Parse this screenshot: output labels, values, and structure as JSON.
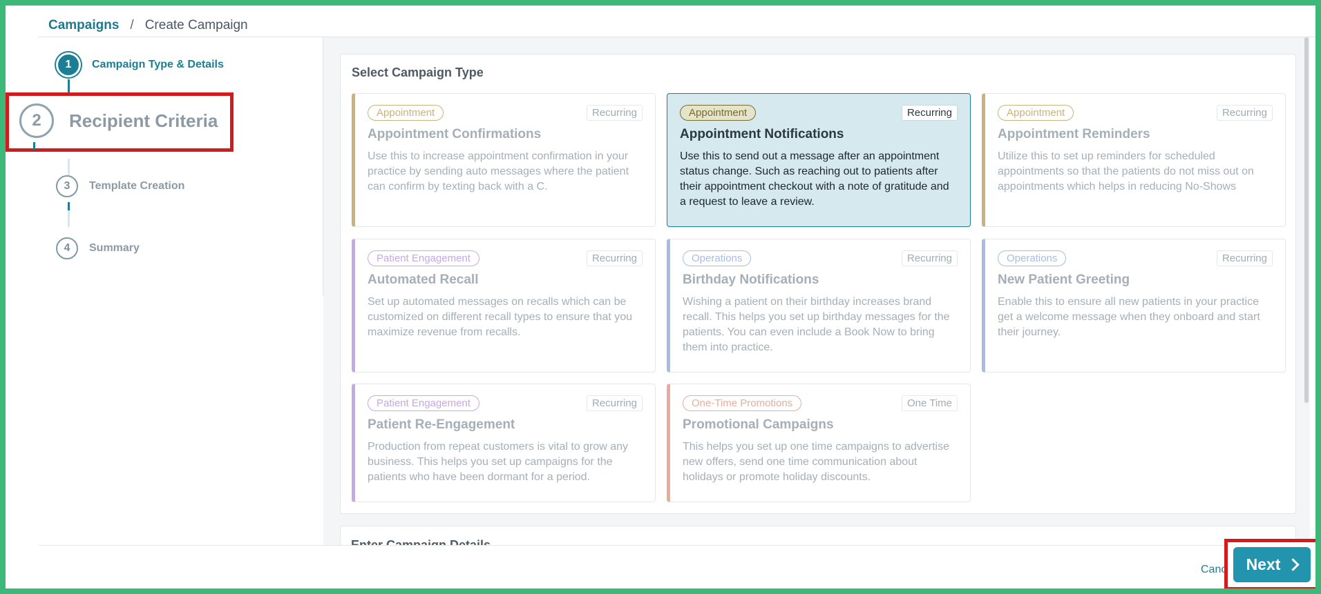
{
  "breadcrumb": {
    "root": "Campaigns",
    "separator": "/",
    "current": "Create Campaign"
  },
  "steps": [
    {
      "number": "1",
      "label": "Campaign Type & Details"
    },
    {
      "number": "2",
      "label": "Recipient Criteria"
    },
    {
      "number": "3",
      "label": "Template Creation"
    },
    {
      "number": "4",
      "label": "Summary"
    }
  ],
  "section": {
    "title": "Select Campaign Type",
    "next_section_title": "Enter Campaign Details"
  },
  "cards": [
    {
      "tag": "Appointment",
      "frequency": "Recurring",
      "title": "Appointment Confirmations",
      "desc": "Use this to increase appointment confirmation in your practice by sending auto messages where the patient can confirm by texting back with a C."
    },
    {
      "tag": "Appointment",
      "frequency": "Recurring",
      "title": "Appointment Notifications",
      "desc": "Use this to send out a message after an appointment status change. Such as reaching out to patients after their appointment checkout with a note of gratitude and a request to leave a review."
    },
    {
      "tag": "Appointment",
      "frequency": "Recurring",
      "title": "Appointment Reminders",
      "desc": "Utilize this to set up reminders for scheduled appointments so that the patients do not miss out on appointments which helps in reducing No-Shows"
    },
    {
      "tag": "Patient Engagement",
      "frequency": "Recurring",
      "title": "Automated Recall",
      "desc": "Set up automated messages on recalls which can be customized on different recall types to ensure that you maximize revenue from recalls."
    },
    {
      "tag": "Operations",
      "frequency": "Recurring",
      "title": "Birthday Notifications",
      "desc": "Wishing a patient on their birthday increases brand recall. This helps you set up birthday messages for the patients. You can even include a Book Now to bring them into practice."
    },
    {
      "tag": "Operations",
      "frequency": "Recurring",
      "title": "New Patient Greeting",
      "desc": "Enable this to ensure all new patients in your practice get a welcome message when they onboard and start their journey."
    },
    {
      "tag": "Patient Engagement",
      "frequency": "Recurring",
      "title": "Patient Re-Engagement",
      "desc": "Production from repeat customers is vital to grow any business. This helps you set up campaigns for the patients who have been dormant for a period."
    },
    {
      "tag": "One-Time Promotions",
      "frequency": "One Time",
      "title": "Promotional Campaigns",
      "desc": "This helps you set up one time campaigns to advertise new offers, send one time communication about holidays or promote holiday discounts."
    }
  ],
  "tag_colors": {
    "appointment": "#c9b37a",
    "appointment_selected": "#7a6a2e",
    "patient_engagement": "#c5a8e6",
    "operations": "#a7bde0",
    "promotions": "#e6ad9c",
    "accent": "#1a7f94"
  },
  "footer": {
    "cancel_label": "Canc",
    "next_label": "Next"
  }
}
